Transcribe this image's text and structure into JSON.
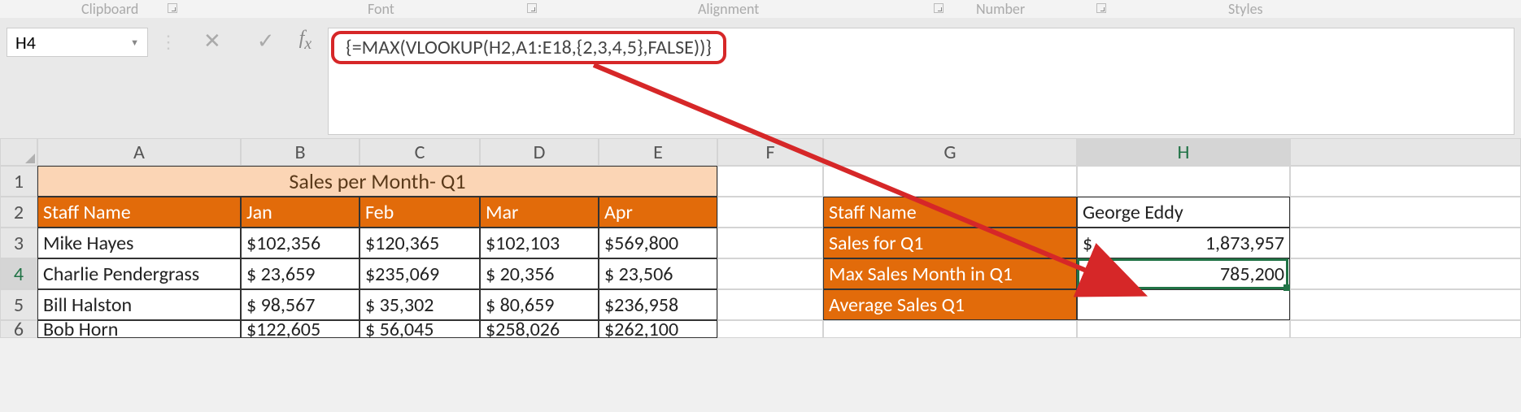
{
  "ribbon": {
    "groups": [
      "Clipboard",
      "Font",
      "Alignment",
      "Number",
      "Styles"
    ]
  },
  "name_box": "H4",
  "formula": "{=MAX(VLOOKUP(H2,A1:E18,{2,3,4,5},FALSE))}",
  "columns": [
    "A",
    "B",
    "C",
    "D",
    "E",
    "F",
    "G",
    "H"
  ],
  "title": "Sales per Month- Q1",
  "headers_left": [
    "Staff Name",
    "Jan",
    "Feb",
    "Mar",
    "Apr"
  ],
  "table_left": [
    {
      "name": "Mike Hayes",
      "vals": [
        "$102,356",
        "$120,365",
        "$102,103",
        "$569,800"
      ]
    },
    {
      "name": "Charlie Pendergrass",
      "vals": [
        "$  23,659",
        "$235,069",
        "$  20,356",
        "$  23,506"
      ]
    },
    {
      "name": "Bill Halston",
      "vals": [
        "$  98,567",
        "$  35,302",
        "$  80,659",
        "$236,958"
      ]
    },
    {
      "name": "Bob Horn",
      "vals": [
        "$122,605",
        "$  56,045",
        "$258,026",
        "$262,100"
      ]
    }
  ],
  "right": {
    "labels": [
      "Staff Name",
      "Sales for Q1",
      "Max Sales Month in Q1",
      "Average Sales Q1"
    ],
    "h2": "George Eddy",
    "h3": {
      "sym": "$",
      "val": "1,873,957"
    },
    "h4": {
      "sym": "$",
      "val": "785,200"
    }
  }
}
